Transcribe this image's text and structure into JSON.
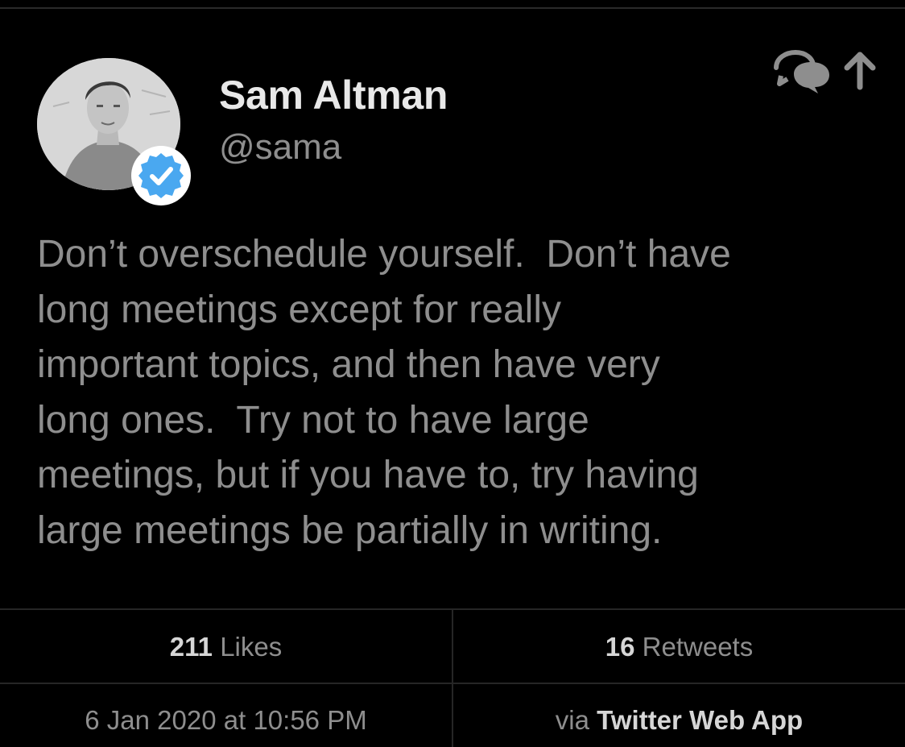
{
  "author": {
    "display_name": "Sam Altman",
    "handle": "@sama",
    "verified": true,
    "avatar_icon": "user-avatar-photo"
  },
  "actions": [
    {
      "icon": "conversation-bubbles-icon"
    },
    {
      "icon": "share-arrow-up-icon"
    }
  ],
  "tweet": {
    "lines": [
      "Don’t overschedule yourself.  Don’t have",
      "long meetings except for really",
      "important topics, and then have very",
      "long ones.  Try not to have large",
      "meetings, but if you have to, try having",
      "large meetings be partially in writing."
    ]
  },
  "stats": {
    "likes_count": "211",
    "likes_label": "Likes",
    "retweets_count": "16",
    "retweets_label": "Retweets"
  },
  "meta": {
    "timestamp": "6 Jan 2020 at 10:56 PM",
    "via_prefix": "via",
    "source": "Twitter Web App"
  },
  "colors": {
    "background": "#000000",
    "primary_text": "#e8e8e8",
    "secondary_text": "#8e8e8e",
    "verified_badge": "#4aa8f0",
    "divider": "#262626"
  }
}
